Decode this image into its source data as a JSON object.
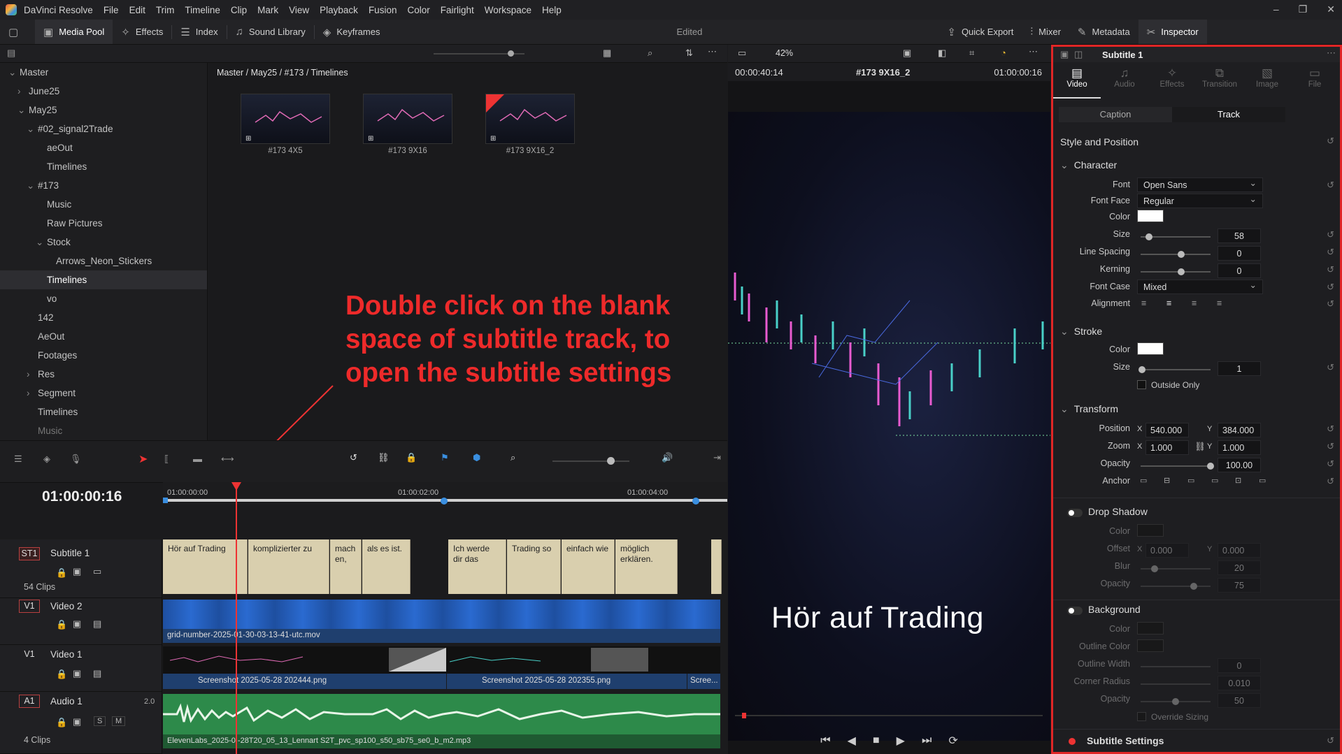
{
  "menubar": {
    "app": "DaVinci Resolve",
    "items": [
      "File",
      "Edit",
      "Trim",
      "Timeline",
      "Clip",
      "Mark",
      "View",
      "Playback",
      "Fusion",
      "Color",
      "Fairlight",
      "Workspace",
      "Help"
    ]
  },
  "toolbar": {
    "media_pool": "Media Pool",
    "effects": "Effects",
    "index": "Index",
    "sound_library": "Sound Library",
    "keyframes": "Keyframes",
    "edited": "Edited",
    "quick_export": "Quick Export",
    "mixer": "Mixer",
    "metadata": "Metadata",
    "inspector": "Inspector"
  },
  "viewer_bar": {
    "zoom": "42%",
    "inspector_title": "Subtitle 1"
  },
  "sidebar": {
    "items": [
      {
        "label": "Master",
        "indent": 0,
        "chev": "⌄"
      },
      {
        "label": "June25",
        "indent": 1,
        "chev": "›"
      },
      {
        "label": "May25",
        "indent": 1,
        "chev": "⌄"
      },
      {
        "label": "#02_signal2Trade",
        "indent": 2,
        "chev": "⌄"
      },
      {
        "label": "aeOut",
        "indent": 3,
        "chev": ""
      },
      {
        "label": "Timelines",
        "indent": 3,
        "chev": ""
      },
      {
        "label": "#173",
        "indent": 2,
        "chev": "⌄"
      },
      {
        "label": "Music",
        "indent": 3,
        "chev": ""
      },
      {
        "label": "Raw Pictures",
        "indent": 3,
        "chev": ""
      },
      {
        "label": "Stock",
        "indent": 3,
        "chev": "⌄"
      },
      {
        "label": "Arrows_Neon_Stickers",
        "indent": 4,
        "chev": ""
      },
      {
        "label": "Timelines",
        "indent": 3,
        "chev": "",
        "sel": true
      },
      {
        "label": "vo",
        "indent": 3,
        "chev": ""
      },
      {
        "label": "142",
        "indent": 2,
        "chev": ""
      },
      {
        "label": "AeOut",
        "indent": 2,
        "chev": ""
      },
      {
        "label": "Footages",
        "indent": 2,
        "chev": ""
      },
      {
        "label": "Res",
        "indent": 2,
        "chev": "›"
      },
      {
        "label": "Segment",
        "indent": 2,
        "chev": "›"
      },
      {
        "label": "Timelines",
        "indent": 2,
        "chev": ""
      },
      {
        "label": "Music",
        "indent": 2,
        "chev": ""
      }
    ]
  },
  "pool": {
    "breadcrumb": "Master / May25 / #173 / Timelines",
    "thumbs": [
      "#173 4X5",
      "#173 9X16",
      "#173 9X16_2"
    ]
  },
  "annotation": "Double click on the blank space of subtitle track, to open the subtitle settings",
  "viewer": {
    "timecode_left": "00:00:40:14",
    "clip_name": "#173 9X16_2",
    "timecode_right": "01:00:00:16",
    "subtitle": "Hör auf Trading"
  },
  "inspector": {
    "tabs": [
      "Video",
      "Audio",
      "Effects",
      "Transition",
      "Image",
      "File"
    ],
    "subtabs": {
      "caption": "Caption",
      "track": "Track"
    },
    "style_position": "Style and Position",
    "character": {
      "title": "Character",
      "font_label": "Font",
      "font": "Open Sans",
      "face_label": "Font Face",
      "face": "Regular",
      "color_label": "Color",
      "size_label": "Size",
      "size": "58",
      "line_spacing_label": "Line Spacing",
      "line_spacing": "0",
      "kerning_label": "Kerning",
      "kerning": "0",
      "case_label": "Font Case",
      "case": "Mixed",
      "alignment_label": "Alignment"
    },
    "stroke": {
      "title": "Stroke",
      "color_label": "Color",
      "size_label": "Size",
      "size": "1",
      "outside_only": "Outside Only"
    },
    "transform": {
      "title": "Transform",
      "position_label": "Position",
      "pos_x": "540.000",
      "pos_y": "384.000",
      "zoom_label": "Zoom",
      "zoom_x": "1.000",
      "zoom_y": "1.000",
      "opacity_label": "Opacity",
      "opacity": "100.00",
      "anchor_label": "Anchor",
      "x": "X",
      "y": "Y"
    },
    "drop_shadow": {
      "title": "Drop Shadow",
      "color_label": "Color",
      "offset_label": "Offset",
      "offset_x": "0.000",
      "offset_y": "0.000",
      "blur_label": "Blur",
      "blur": "20",
      "opacity_label": "Opacity",
      "opacity": "75"
    },
    "background": {
      "title": "Background",
      "color_label": "Color",
      "outline_color_label": "Outline Color",
      "outline_width_label": "Outline Width",
      "outline_width": "0",
      "corner_radius_label": "Corner Radius",
      "corner_radius": "0.010",
      "opacity_label": "Opacity",
      "opacity": "50",
      "override": "Override Sizing"
    },
    "subtitle_settings": "Subtitle Settings"
  },
  "timeline": {
    "timecode": "01:00:00:16",
    "ruler": [
      "01:00:00:00",
      "01:00:02:00",
      "01:00:04:00"
    ],
    "tracks": {
      "st1": {
        "badge": "ST1",
        "name": "Subtitle 1",
        "clips": "54 Clips"
      },
      "v2": {
        "badge": "V1",
        "name": "Video 2"
      },
      "v1": {
        "badge": "V1",
        "name": "Video 1"
      },
      "a1": {
        "badge": "A1",
        "name": "Audio 1",
        "level": "2.0",
        "clips": "4 Clips",
        "s": "S",
        "m": "M"
      }
    },
    "subtitle_clips": [
      "Hör auf Trading",
      "komplizierter zu",
      "mach en,",
      "als es ist.",
      "Ich werde dir das",
      "Trading so",
      "einfach wie",
      "möglich erklären."
    ],
    "v2_clip": "grid-number-2025-01-30-03-13-41-utc.mov",
    "v1_clip_a": "Screenshot 2025-05-28 202444.png",
    "v1_clip_b": "Screenshot 2025-05-28 202355.png",
    "v1_clip_c": "Scree...",
    "a1_clip": "ElevenLabs_2025-0 -28T20_05_13_Lennart S2T_pvc_sp100_s50_sb75_se0_b_m2.mp3"
  }
}
